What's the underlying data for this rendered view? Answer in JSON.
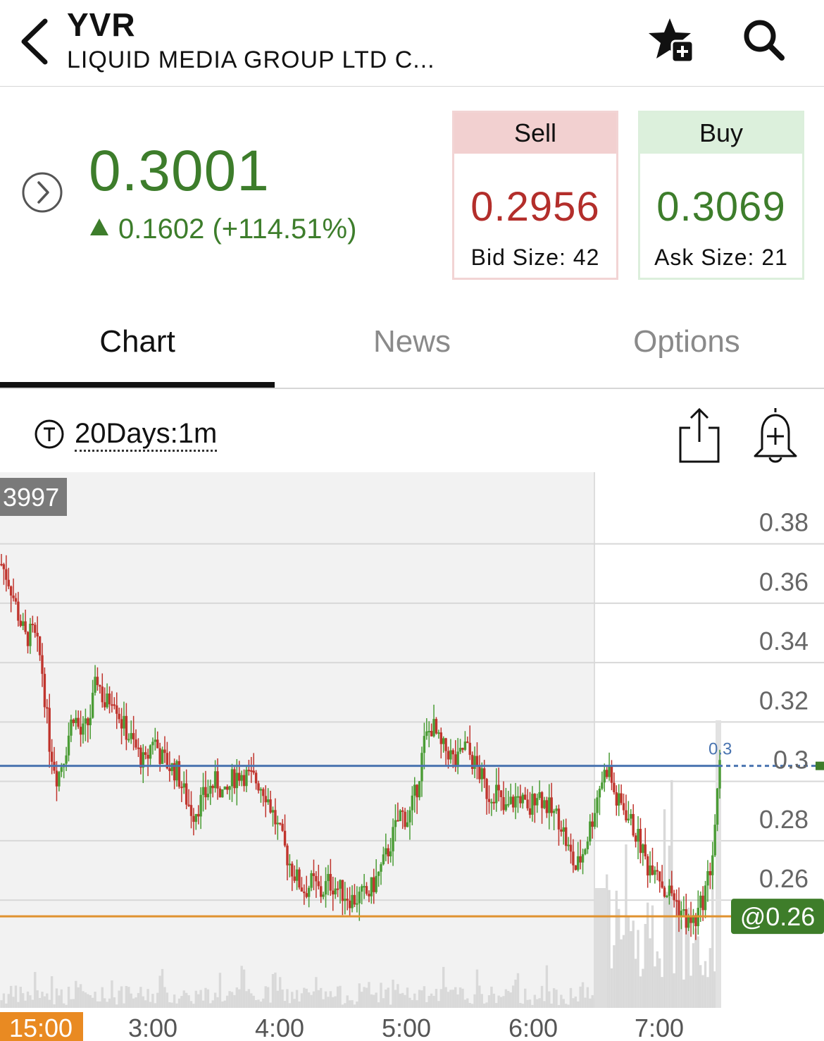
{
  "header": {
    "ticker": "YVR",
    "company_name": "LIQUID MEDIA GROUP LTD C...",
    "icons": {
      "back": "chevron-left-icon",
      "watchlist": "star-plus-icon",
      "search": "search-icon"
    }
  },
  "quote": {
    "last_price": "0.3001",
    "change": "0.1602 (+114.51%)",
    "direction": "up",
    "color_up": "#3d7d2b",
    "color_down": "#b32e2b"
  },
  "sell": {
    "label": "Sell",
    "price": "0.2956",
    "size_text": "Bid Size: 42"
  },
  "buy": {
    "label": "Buy",
    "price": "0.3069",
    "size_text": "Ask Size: 21"
  },
  "tabs": [
    {
      "label": "Chart",
      "active": true
    },
    {
      "label": "News",
      "active": false
    },
    {
      "label": "Options",
      "active": false
    }
  ],
  "toolbar": {
    "period": "20Days:1m",
    "icons": {
      "period": "t-circle-icon",
      "share": "share-icon",
      "alert": "bell-plus-icon"
    }
  },
  "chart_data": {
    "type": "candlestick",
    "x_labels": [
      "15:00",
      "3:00",
      "4:00",
      "5:00",
      "6:00",
      "7:00"
    ],
    "y_ticks": [
      0.38,
      0.36,
      0.34,
      0.32,
      0.3,
      0.28,
      0.26
    ],
    "ylim": [
      0.2185,
      0.3989
    ],
    "high_label": "3997",
    "last_price_line": 0.3,
    "last_price_line_label": "0.3",
    "order_line": 0.26,
    "order_line_label": "@0.26",
    "colors": {
      "up": "#4a9c35",
      "down": "#c0342d",
      "price_line": "#4a74b0",
      "order_line": "#e0922f",
      "order_label_bg": "#3e7d2a",
      "time_label_bg": "#e98a22"
    },
    "close_path": [
      [
        0.0,
        0.368
      ],
      [
        0.01,
        0.362
      ],
      [
        0.02,
        0.352
      ],
      [
        0.03,
        0.343
      ],
      [
        0.04,
        0.345
      ],
      [
        0.05,
        0.335
      ],
      [
        0.06,
        0.308
      ],
      [
        0.07,
        0.296
      ],
      [
        0.08,
        0.305
      ],
      [
        0.09,
        0.318
      ],
      [
        0.1,
        0.31
      ],
      [
        0.11,
        0.315
      ],
      [
        0.12,
        0.33
      ],
      [
        0.13,
        0.32
      ],
      [
        0.14,
        0.325
      ],
      [
        0.15,
        0.315
      ],
      [
        0.16,
        0.31
      ],
      [
        0.17,
        0.305
      ],
      [
        0.18,
        0.3
      ],
      [
        0.19,
        0.31
      ],
      [
        0.2,
        0.303
      ],
      [
        0.21,
        0.3
      ],
      [
        0.22,
        0.298
      ],
      [
        0.23,
        0.29
      ],
      [
        0.24,
        0.284
      ],
      [
        0.25,
        0.288
      ],
      [
        0.26,
        0.292
      ],
      [
        0.27,
        0.295
      ],
      [
        0.28,
        0.289
      ],
      [
        0.29,
        0.296
      ],
      [
        0.3,
        0.298
      ],
      [
        0.31,
        0.296
      ],
      [
        0.32,
        0.295
      ],
      [
        0.33,
        0.292
      ],
      [
        0.34,
        0.284
      ],
      [
        0.35,
        0.276
      ],
      [
        0.36,
        0.268
      ],
      [
        0.37,
        0.262
      ],
      [
        0.38,
        0.258
      ],
      [
        0.39,
        0.261
      ],
      [
        0.4,
        0.257
      ],
      [
        0.41,
        0.261
      ],
      [
        0.42,
        0.259
      ],
      [
        0.43,
        0.257
      ],
      [
        0.44,
        0.255
      ],
      [
        0.45,
        0.256
      ],
      [
        0.46,
        0.257
      ],
      [
        0.47,
        0.262
      ],
      [
        0.48,
        0.268
      ],
      [
        0.49,
        0.276
      ],
      [
        0.5,
        0.284
      ],
      [
        0.51,
        0.282
      ],
      [
        0.52,
        0.292
      ],
      [
        0.53,
        0.308
      ],
      [
        0.54,
        0.314
      ],
      [
        0.55,
        0.306
      ],
      [
        0.56,
        0.305
      ],
      [
        0.57,
        0.3
      ],
      [
        0.58,
        0.307
      ],
      [
        0.59,
        0.302
      ],
      [
        0.6,
        0.297
      ],
      [
        0.61,
        0.29
      ],
      [
        0.62,
        0.292
      ],
      [
        0.63,
        0.284
      ],
      [
        0.64,
        0.288
      ],
      [
        0.65,
        0.29
      ],
      [
        0.66,
        0.283
      ],
      [
        0.67,
        0.292
      ],
      [
        0.68,
        0.288
      ],
      [
        0.69,
        0.284
      ],
      [
        0.7,
        0.282
      ],
      [
        0.71,
        0.272
      ],
      [
        0.72,
        0.265
      ],
      [
        0.73,
        0.272
      ],
      [
        0.74,
        0.282
      ],
      [
        0.75,
        0.294
      ],
      [
        0.76,
        0.3
      ],
      [
        0.77,
        0.288
      ],
      [
        0.78,
        0.286
      ],
      [
        0.79,
        0.28
      ],
      [
        0.8,
        0.274
      ],
      [
        0.81,
        0.266
      ],
      [
        0.82,
        0.268
      ],
      [
        0.83,
        0.258
      ],
      [
        0.84,
        0.257
      ],
      [
        0.85,
        0.252
      ],
      [
        0.86,
        0.247
      ],
      [
        0.87,
        0.248
      ],
      [
        0.88,
        0.256
      ],
      [
        0.89,
        0.268
      ],
      [
        0.9,
        0.299
      ]
    ]
  }
}
